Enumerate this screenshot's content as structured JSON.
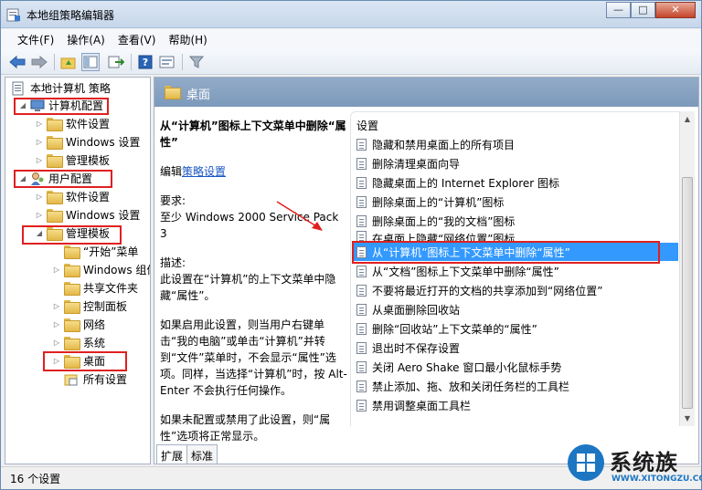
{
  "window": {
    "title": "本地组策略编辑器",
    "min": "—",
    "max": "□",
    "close": "✕"
  },
  "menubar": [
    "文件(F)",
    "操作(A)",
    "查看(V)",
    "帮助(H)"
  ],
  "tree": {
    "root": "本地计算机 策略",
    "computer_config": "计算机配置",
    "cc_software": "软件设置",
    "cc_windows": "Windows 设置",
    "cc_admin": "管理模板",
    "user_config": "用户配置",
    "uc_software": "软件设置",
    "uc_windows": "Windows 设置",
    "uc_admin": "管理模板",
    "start_menu": "“开始”菜单",
    "windows_components": "Windows 组件",
    "shared_folders": "共享文件夹",
    "control_panel": "控制面板",
    "network": "网络",
    "system": "系统",
    "desktop": "桌面",
    "all_settings": "所有设置"
  },
  "right_header": "桌面",
  "description": {
    "title": "从“计算机”图标上下文菜单中删除“属性”",
    "edit_prefix": "编辑",
    "edit_link": "策略设置",
    "requirements_label": "要求:",
    "requirements": "至少 Windows 2000 Service Pack 3",
    "desc_label": "描述:",
    "desc": "此设置在“计算机”的上下文菜单中隐藏“属性”。",
    "enabled": "如果启用此设置，则当用户右键单击“我的电脑”或单击“计算机”并转到“文件”菜单时，不会显示“属性”选项。同样，当选择“计算机”时，按 Alt-Enter 不会执行任何操作。",
    "disabled": "如果未配置或禁用了此设置，则“属性”选项将正常显示。"
  },
  "list": {
    "header": "设置",
    "items": [
      "隐藏和禁用桌面上的所有项目",
      "删除清理桌面向导",
      "隐藏桌面上的 Internet Explorer 图标",
      "删除桌面上的“计算机”图标",
      "删除桌面上的“我的文档”图标",
      "在桌面上隐藏“网络位置”图标",
      "从“计算机”图标上下文菜单中删除“属性”",
      "从“文档”图标上下文菜单中删除“属性”",
      "不要将最近打开的文档的共享添加到“网络位置”",
      "从桌面删除回收站",
      "删除“回收站”上下文菜单的“属性”",
      "退出时不保存设置",
      "关闭 Aero Shake 窗口最小化鼠标手势",
      "禁止添加、拖、放和关闭任务栏的工具栏",
      "禁用调整桌面工具栏"
    ]
  },
  "tabs": [
    "扩展",
    "标准"
  ],
  "status": "16 个设置",
  "watermark": {
    "text": "系统族",
    "sub": "WWW.XITONGZU.COM"
  },
  "colors": {
    "selected": "#3399ff",
    "highlight": "#e02020",
    "header": "#8aa5c4"
  }
}
